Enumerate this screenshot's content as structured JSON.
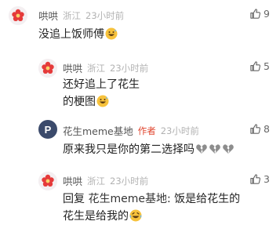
{
  "comments": [
    {
      "username": "哄哄",
      "location": "浙江",
      "time": "23小时前",
      "likes": "9",
      "text": "没追上饭师傅",
      "emoji": "grinning-sweat-emoji"
    },
    {
      "username": "哄哄",
      "location": "浙江",
      "time": "23小时前",
      "likes": "5",
      "text_line1": "还好追上了花生",
      "text_line2": "的梗图",
      "emoji": "grinning-sweat-emoji"
    },
    {
      "username": "花生meme基地",
      "author_tag": "作者",
      "time": "23小时前",
      "likes": "8",
      "text": "原来我只是你的第二选择吗",
      "emoji": "broken-heart-emoji"
    },
    {
      "username": "哄哄",
      "location": "浙江",
      "time": "23小时前",
      "likes": "3",
      "reply_prefix": "回复",
      "reply_to": "花生meme基地",
      "text_line1": ": 饭是给花生的",
      "text_line2": "花生是给我的",
      "emoji": "laughing-tears-emoji"
    }
  ],
  "avatar_letter": "P",
  "colors": {
    "author_tag": "#e0452e",
    "meta_gray": "#b2b2b2",
    "avatar_dark": "#3b4a6b"
  }
}
